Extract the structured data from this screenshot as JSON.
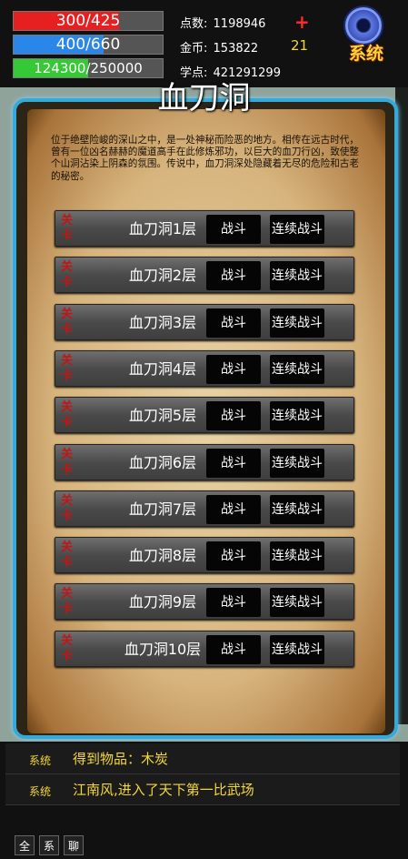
{
  "status": {
    "hp": {
      "text": "300/425",
      "fraction": 0.706
    },
    "mp": {
      "text": "400/660",
      "fraction": 0.606
    },
    "xp": {
      "text": "124300/250000",
      "fraction": 0.497
    },
    "points_label": "点数:",
    "points_value": "1198946",
    "gold_label": "金币:",
    "gold_value": "153822",
    "study_label": "学点:",
    "study_value": "421291299",
    "plus_icon": "+",
    "count": "21"
  },
  "system_button": {
    "label": "系统",
    "icon": "gear-icon"
  },
  "dialog": {
    "title": "血刀洞",
    "description": "位于绝壁险峻的深山之中，是一处神秘而险恶的地方。相传在远古时代，曾有一位凶名赫赫的魔道高手在此修炼邪功，以巨大的血刀行凶，致使整个山洞沾染上阴森的氛围。传说中，血刀洞深处隐藏着无尽的危险和古老的秘密。",
    "mark": "关卡",
    "fight_label": "战斗",
    "continuous_label": "连续战斗",
    "levels": [
      "血刀洞1层",
      "血刀洞2层",
      "血刀洞3层",
      "血刀洞4层",
      "血刀洞5层",
      "血刀洞6层",
      "血刀洞7层",
      "血刀洞8层",
      "血刀洞9层",
      "血刀洞10层"
    ]
  },
  "chat": {
    "lines": [
      {
        "channel": "系统",
        "message": "得到物品：木炭"
      },
      {
        "channel": "系统",
        "message": "江南风,进入了天下第一比武场"
      }
    ],
    "tabs": [
      "全",
      "系",
      "聊"
    ]
  },
  "colors": {
    "hp": "#e62020",
    "mp": "#2a86e8",
    "xp": "#36c936",
    "frame": "#36a9d8",
    "accent": "#f3d73a"
  }
}
